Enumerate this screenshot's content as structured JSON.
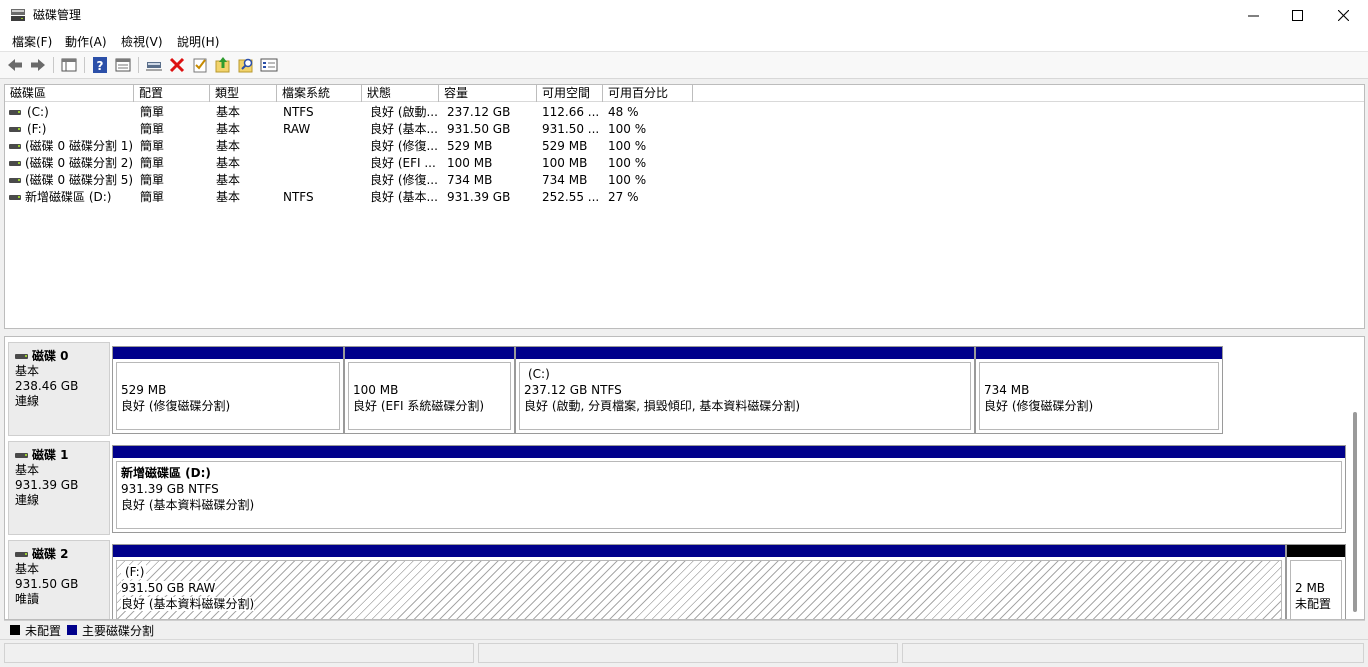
{
  "window": {
    "title": "磁碟管理"
  },
  "menu": [
    {
      "label": "檔案(F)"
    },
    {
      "label": "動作(A)"
    },
    {
      "label": "檢視(V)"
    },
    {
      "label": "說明(H)"
    }
  ],
  "toolbar_icons": [
    "back-icon",
    "forward-icon",
    "show-hide-console-tree-icon",
    "help-icon",
    "properties-icon",
    "connect-icon",
    "delete-icon",
    "checkmark-icon",
    "export-icon",
    "search-icon",
    "list-icon"
  ],
  "columns": [
    {
      "label": "磁碟區"
    },
    {
      "label": "配置"
    },
    {
      "label": "類型"
    },
    {
      "label": "檔案系統"
    },
    {
      "label": "狀態"
    },
    {
      "label": "容量"
    },
    {
      "label": "可用空間"
    },
    {
      "label": "可用百分比"
    }
  ],
  "volumes": [
    {
      "name": "(C:)",
      "layout": "簡單",
      "type": "基本",
      "fs": "NTFS",
      "status": "良好 (啟動...",
      "capacity": "237.12 GB",
      "free": "112.66 ...",
      "pct": "48 %"
    },
    {
      "name": "(F:)",
      "layout": "簡單",
      "type": "基本",
      "fs": "RAW",
      "status": "良好 (基本...",
      "capacity": "931.50 GB",
      "free": "931.50 ...",
      "pct": "100 %"
    },
    {
      "name": "(磁碟 0 磁碟分割 1)",
      "layout": "簡單",
      "type": "基本",
      "fs": "",
      "status": "良好 (修復...",
      "capacity": "529 MB",
      "free": "529 MB",
      "pct": "100 %"
    },
    {
      "name": "(磁碟 0 磁碟分割 2)",
      "layout": "簡單",
      "type": "基本",
      "fs": "",
      "status": "良好 (EFI ...",
      "capacity": "100 MB",
      "free": "100 MB",
      "pct": "100 %"
    },
    {
      "name": "(磁碟 0 磁碟分割 5)",
      "layout": "簡單",
      "type": "基本",
      "fs": "",
      "status": "良好 (修復...",
      "capacity": "734 MB",
      "free": "734 MB",
      "pct": "100 %"
    },
    {
      "name": "新增磁碟區 (D:)",
      "layout": "簡單",
      "type": "基本",
      "fs": "NTFS",
      "status": "良好 (基本...",
      "capacity": "931.39 GB",
      "free": "252.55 ...",
      "pct": "27 %"
    }
  ],
  "disks": [
    {
      "name": "磁碟 0",
      "type": "基本",
      "size": "238.46 GB",
      "state": "連線",
      "partitions": [
        {
          "title": "",
          "line1": "529 MB",
          "line2": "良好 (修復磁碟分割)"
        },
        {
          "title": "",
          "line1": "100 MB",
          "line2": "良好 (EFI 系統磁碟分割)"
        },
        {
          "title": "(C:)",
          "line1": "237.12 GB NTFS",
          "line2": "良好 (啟動, 分頁檔案, 損毀傾印, 基本資料磁碟分割)"
        },
        {
          "title": "",
          "line1": "734 MB",
          "line2": "良好 (修復磁碟分割)"
        }
      ]
    },
    {
      "name": "磁碟 1",
      "type": "基本",
      "size": "931.39 GB",
      "state": "連線",
      "partitions": [
        {
          "title": "新增磁碟區  (D:)",
          "line1": "931.39 GB NTFS",
          "line2": "良好 (基本資料磁碟分割)"
        }
      ]
    },
    {
      "name": "磁碟 2",
      "type": "基本",
      "size": "931.50 GB",
      "state": "唯讀",
      "partitions": [
        {
          "title": "(F:)",
          "line1": "931.50 GB RAW",
          "line2": "良好 (基本資料磁碟分割)"
        },
        {
          "title": "",
          "line1": "2 MB",
          "line2": "未配置"
        }
      ]
    }
  ],
  "legend": [
    {
      "label": "未配置",
      "color": "#000000"
    },
    {
      "label": "主要磁碟分割",
      "color": "#00008b"
    }
  ],
  "colors": {
    "primary_partition": "#00008b",
    "unallocated": "#000000"
  }
}
